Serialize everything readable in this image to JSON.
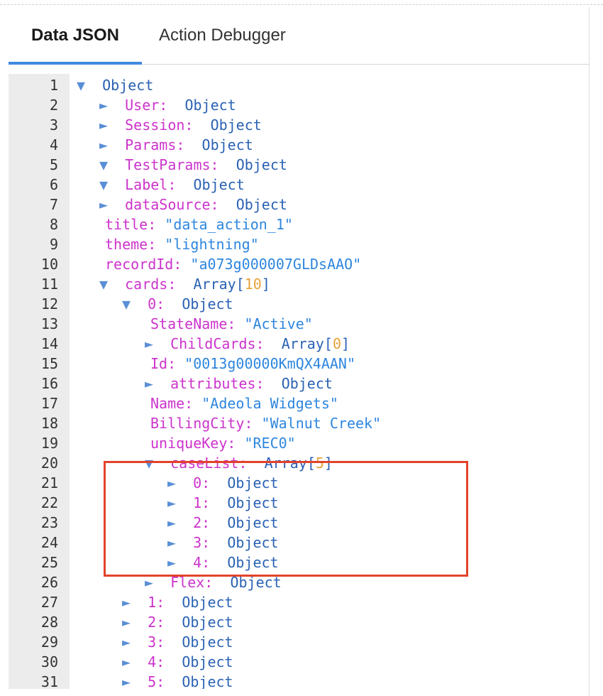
{
  "tabs": {
    "data_json": "Data JSON",
    "action_debugger": "Action Debugger"
  },
  "colors": {
    "accent": "#3f8be0",
    "key": "#cc33cc",
    "value": "#2a62b4",
    "string": "#2e86de",
    "number": "#e8a13c",
    "highlight": "#e2432a"
  },
  "lines": [
    {
      "n": "1",
      "indent": 0,
      "arrow": "▼",
      "key": "",
      "sep": "",
      "parts": [
        [
          "val",
          "Object"
        ]
      ]
    },
    {
      "n": "2",
      "indent": 1,
      "arrow": "►",
      "key": "User:",
      "sep": "  ",
      "parts": [
        [
          "val",
          "Object"
        ]
      ]
    },
    {
      "n": "3",
      "indent": 1,
      "arrow": "►",
      "key": "Session:",
      "sep": "  ",
      "parts": [
        [
          "val",
          "Object"
        ]
      ]
    },
    {
      "n": "4",
      "indent": 1,
      "arrow": "►",
      "key": "Params:",
      "sep": "  ",
      "parts": [
        [
          "val",
          "Object"
        ]
      ]
    },
    {
      "n": "5",
      "indent": 1,
      "arrow": "▼",
      "key": "TestParams:",
      "sep": "  ",
      "parts": [
        [
          "val",
          "Object"
        ]
      ]
    },
    {
      "n": "6",
      "indent": 1,
      "arrow": "▼",
      "key": "Label:",
      "sep": "  ",
      "parts": [
        [
          "val",
          "Object"
        ]
      ]
    },
    {
      "n": "7",
      "indent": 1,
      "arrow": "►",
      "key": "dataSource:",
      "sep": "  ",
      "parts": [
        [
          "val",
          "Object"
        ]
      ]
    },
    {
      "n": "8",
      "indent": 1,
      "arrow": "",
      "key": "title:",
      "sep": " ",
      "parts": [
        [
          "str",
          "\"data_action_1\""
        ]
      ]
    },
    {
      "n": "9",
      "indent": 1,
      "arrow": "",
      "key": "theme:",
      "sep": " ",
      "parts": [
        [
          "str",
          "\"lightning\""
        ]
      ]
    },
    {
      "n": "10",
      "indent": 1,
      "arrow": "",
      "key": "recordId:",
      "sep": " ",
      "parts": [
        [
          "str",
          "\"a073g000007GLDsAAO\""
        ]
      ]
    },
    {
      "n": "11",
      "indent": 1,
      "arrow": "▼",
      "key": "cards:",
      "sep": "  ",
      "parts": [
        [
          "val",
          "Array["
        ],
        [
          "num",
          "10"
        ],
        [
          "val",
          "]"
        ]
      ]
    },
    {
      "n": "12",
      "indent": 2,
      "arrow": "▼",
      "key": "0:",
      "sep": "  ",
      "parts": [
        [
          "val",
          "Object"
        ]
      ]
    },
    {
      "n": "13",
      "indent": 3,
      "arrow": "",
      "key": "StateName:",
      "sep": " ",
      "parts": [
        [
          "str",
          "\"Active\""
        ]
      ]
    },
    {
      "n": "14",
      "indent": 3,
      "arrow": "►",
      "key": "ChildCards:",
      "sep": "  ",
      "parts": [
        [
          "val",
          "Array["
        ],
        [
          "num",
          "0"
        ],
        [
          "val",
          "]"
        ]
      ]
    },
    {
      "n": "15",
      "indent": 3,
      "arrow": "",
      "key": "Id:",
      "sep": " ",
      "parts": [
        [
          "str",
          "\"0013g00000KmQX4AAN\""
        ]
      ]
    },
    {
      "n": "16",
      "indent": 3,
      "arrow": "►",
      "key": "attributes:",
      "sep": "  ",
      "parts": [
        [
          "val",
          "Object"
        ]
      ]
    },
    {
      "n": "17",
      "indent": 3,
      "arrow": "",
      "key": "Name:",
      "sep": " ",
      "parts": [
        [
          "str",
          "\"Adeola Widgets\""
        ]
      ]
    },
    {
      "n": "18",
      "indent": 3,
      "arrow": "",
      "key": "BillingCity:",
      "sep": " ",
      "parts": [
        [
          "str",
          "\"Walnut Creek\""
        ]
      ]
    },
    {
      "n": "19",
      "indent": 3,
      "arrow": "",
      "key": "uniqueKey:",
      "sep": " ",
      "parts": [
        [
          "str",
          "\"REC0\""
        ]
      ]
    },
    {
      "n": "20",
      "indent": 3,
      "arrow": "▼",
      "key": "caseList:",
      "sep": "  ",
      "parts": [
        [
          "val",
          "Array["
        ],
        [
          "num",
          "5"
        ],
        [
          "val",
          "]"
        ]
      ]
    },
    {
      "n": "21",
      "indent": 4,
      "arrow": "►",
      "key": "0:",
      "sep": "  ",
      "parts": [
        [
          "val",
          "Object"
        ]
      ]
    },
    {
      "n": "22",
      "indent": 4,
      "arrow": "►",
      "key": "1:",
      "sep": "  ",
      "parts": [
        [
          "val",
          "Object"
        ]
      ]
    },
    {
      "n": "23",
      "indent": 4,
      "arrow": "►",
      "key": "2:",
      "sep": "  ",
      "parts": [
        [
          "val",
          "Object"
        ]
      ]
    },
    {
      "n": "24",
      "indent": 4,
      "arrow": "►",
      "key": "3:",
      "sep": "  ",
      "parts": [
        [
          "val",
          "Object"
        ]
      ]
    },
    {
      "n": "25",
      "indent": 4,
      "arrow": "►",
      "key": "4:",
      "sep": "  ",
      "parts": [
        [
          "val",
          "Object"
        ]
      ]
    },
    {
      "n": "26",
      "indent": 3,
      "arrow": "►",
      "key": "Flex:",
      "sep": "  ",
      "parts": [
        [
          "val",
          "Object"
        ]
      ]
    },
    {
      "n": "27",
      "indent": 2,
      "arrow": "►",
      "key": "1:",
      "sep": "  ",
      "parts": [
        [
          "val",
          "Object"
        ]
      ]
    },
    {
      "n": "28",
      "indent": 2,
      "arrow": "►",
      "key": "2:",
      "sep": "  ",
      "parts": [
        [
          "val",
          "Object"
        ]
      ]
    },
    {
      "n": "29",
      "indent": 2,
      "arrow": "►",
      "key": "3:",
      "sep": "  ",
      "parts": [
        [
          "val",
          "Object"
        ]
      ]
    },
    {
      "n": "30",
      "indent": 2,
      "arrow": "►",
      "key": "4:",
      "sep": "  ",
      "parts": [
        [
          "val",
          "Object"
        ]
      ]
    },
    {
      "n": "31",
      "indent": 2,
      "arrow": "►",
      "key": "5:",
      "sep": "  ",
      "parts": [
        [
          "val",
          "Object"
        ]
      ]
    }
  ]
}
